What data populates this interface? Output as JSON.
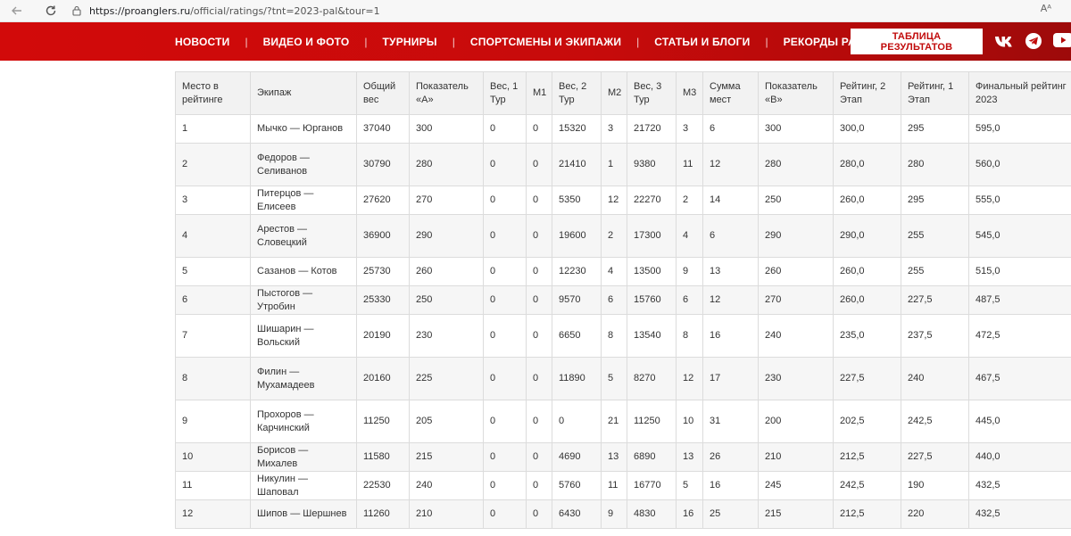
{
  "browser": {
    "url_host": "https://proanglers.ru",
    "url_path": "/official/ratings/?tnt=2023-pal&tour=1",
    "read_aloud": "Aᴬ"
  },
  "menu": [
    {
      "label": "НОВОСТИ"
    },
    {
      "label": "ВИДЕО И ФОТО"
    },
    {
      "label": "ТУРНИРЫ"
    },
    {
      "label": "СПОРТСМЕНЫ И ЭКИПАЖИ"
    },
    {
      "label": "СТАТЬИ И БЛОГИ"
    },
    {
      "label": "РЕКОРДЫ PAL"
    }
  ],
  "menu_separator": "|",
  "results_button": "ТАБЛИЦА РЕЗУЛЬТАТОВ",
  "social": {
    "vk": "vk-icon",
    "telegram": "telegram-icon",
    "youtube": "youtube-icon"
  },
  "colors": {
    "brand_red": "#d20a0a",
    "header_dark": "#9d0a0a"
  },
  "table": {
    "headers": [
      "Место в рейтинге",
      "Экипаж",
      "Общий вес",
      "Показатель «А»",
      "Вес, 1 Тур",
      "М1",
      "Вес, 2 Тур",
      "М2",
      "Вес, 3 Тур",
      "М3",
      "Сумма мест",
      "Показатель «В»",
      "Рейтинг, 2 Этап",
      "Рейтинг, 1 Этап",
      "Финальный рейтинг 2023"
    ],
    "rows": [
      [
        "1",
        "Мычко — Юрганов",
        "37040",
        "300",
        "0",
        "0",
        "15320",
        "3",
        "21720",
        "3",
        "6",
        "300",
        "300,0",
        "295",
        "595,0"
      ],
      [
        "2",
        "Федоров — Селиванов",
        "30790",
        "280",
        "0",
        "0",
        "21410",
        "1",
        "9380",
        "11",
        "12",
        "280",
        "280,0",
        "280",
        "560,0"
      ],
      [
        "3",
        "Питерцов — Елисеев",
        "27620",
        "270",
        "0",
        "0",
        "5350",
        "12",
        "22270",
        "2",
        "14",
        "250",
        "260,0",
        "295",
        "555,0"
      ],
      [
        "4",
        "Арестов — Словецкий",
        "36900",
        "290",
        "0",
        "0",
        "19600",
        "2",
        "17300",
        "4",
        "6",
        "290",
        "290,0",
        "255",
        "545,0"
      ],
      [
        "5",
        "Сазанов — Котов",
        "25730",
        "260",
        "0",
        "0",
        "12230",
        "4",
        "13500",
        "9",
        "13",
        "260",
        "260,0",
        "255",
        "515,0"
      ],
      [
        "6",
        "Пыстогов — Утробин",
        "25330",
        "250",
        "0",
        "0",
        "9570",
        "6",
        "15760",
        "6",
        "12",
        "270",
        "260,0",
        "227,5",
        "487,5"
      ],
      [
        "7",
        "Шишарин — Вольский",
        "20190",
        "230",
        "0",
        "0",
        "6650",
        "8",
        "13540",
        "8",
        "16",
        "240",
        "235,0",
        "237,5",
        "472,5"
      ],
      [
        "8",
        "Филин — Мухамадеев",
        "20160",
        "225",
        "0",
        "0",
        "11890",
        "5",
        "8270",
        "12",
        "17",
        "230",
        "227,5",
        "240",
        "467,5"
      ],
      [
        "9",
        "Прохоров — Карчинский",
        "11250",
        "205",
        "0",
        "0",
        "0",
        "21",
        "11250",
        "10",
        "31",
        "200",
        "202,5",
        "242,5",
        "445,0"
      ],
      [
        "10",
        "Борисов — Михалев",
        "11580",
        "215",
        "0",
        "0",
        "4690",
        "13",
        "6890",
        "13",
        "26",
        "210",
        "212,5",
        "227,5",
        "440,0"
      ],
      [
        "11",
        "Никулин — Шаповал",
        "22530",
        "240",
        "0",
        "0",
        "5760",
        "11",
        "16770",
        "5",
        "16",
        "245",
        "242,5",
        "190",
        "432,5"
      ],
      [
        "12",
        "Шипов — Шершнев",
        "11260",
        "210",
        "0",
        "0",
        "6430",
        "9",
        "4830",
        "16",
        "25",
        "215",
        "212,5",
        "220",
        "432,5"
      ]
    ]
  }
}
